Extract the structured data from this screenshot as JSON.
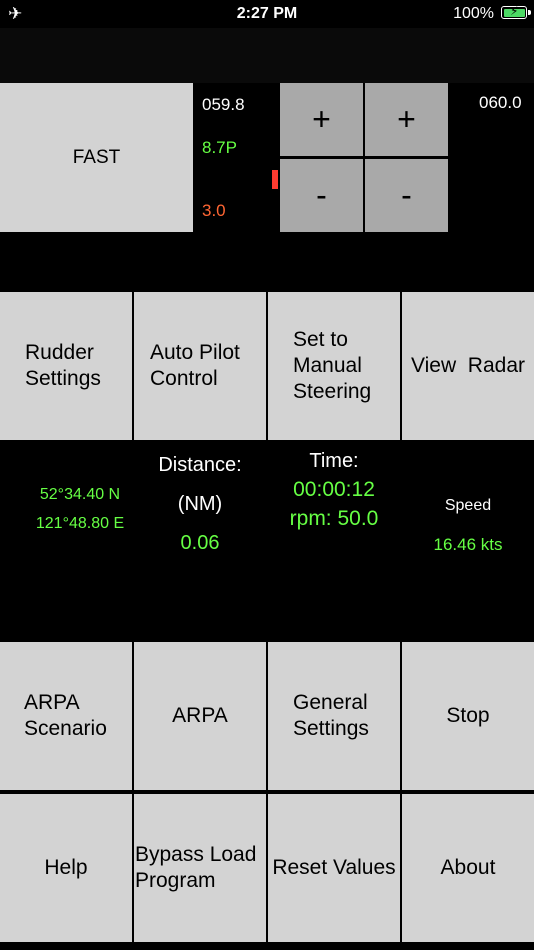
{
  "status_bar": {
    "time": "2:27 PM",
    "battery_percent": "100%",
    "airplane_icon": "airplane-icon",
    "battery_icon": "battery-charging-icon"
  },
  "top_panel": {
    "speed_mode": "FAST",
    "heading_current": "059.8",
    "rudder_value": "8.7P",
    "rate_value": "3.0",
    "heading_target": "060.0",
    "plus_label": "+",
    "minus_label": "-"
  },
  "row1": {
    "rudder_settings": [
      "Rudder",
      "Settings"
    ],
    "auto_pilot": [
      "Auto Pilot",
      "Control"
    ],
    "manual_steering": [
      "Set to",
      "Manual",
      "Steering"
    ],
    "view_radar": "View  Radar"
  },
  "info": {
    "lat": "52°34.40 N",
    "lon": "121°48.80 E",
    "distance_label": "Distance:",
    "distance_unit": "(NM)",
    "distance_value": "0.06",
    "time_label": "Time:",
    "time_value": "00:00:12",
    "rpm": "rpm: 50.0",
    "speed_label": "Speed",
    "speed_value": "16.46 kts"
  },
  "row2": {
    "arpa_scenario": [
      "ARPA",
      "Scenario"
    ],
    "arpa": "ARPA",
    "general_settings": [
      "General",
      "Settings"
    ],
    "stop": "Stop"
  },
  "row3": {
    "help": "Help",
    "bypass": [
      "Bypass Load",
      "Program"
    ],
    "reset": "Reset Values",
    "about": "About"
  },
  "colors": {
    "button_bg": "#d3d3d3",
    "stepper_bg": "#a9a9a9",
    "green_text": "#66ff44",
    "red_text": "#ff6633"
  }
}
